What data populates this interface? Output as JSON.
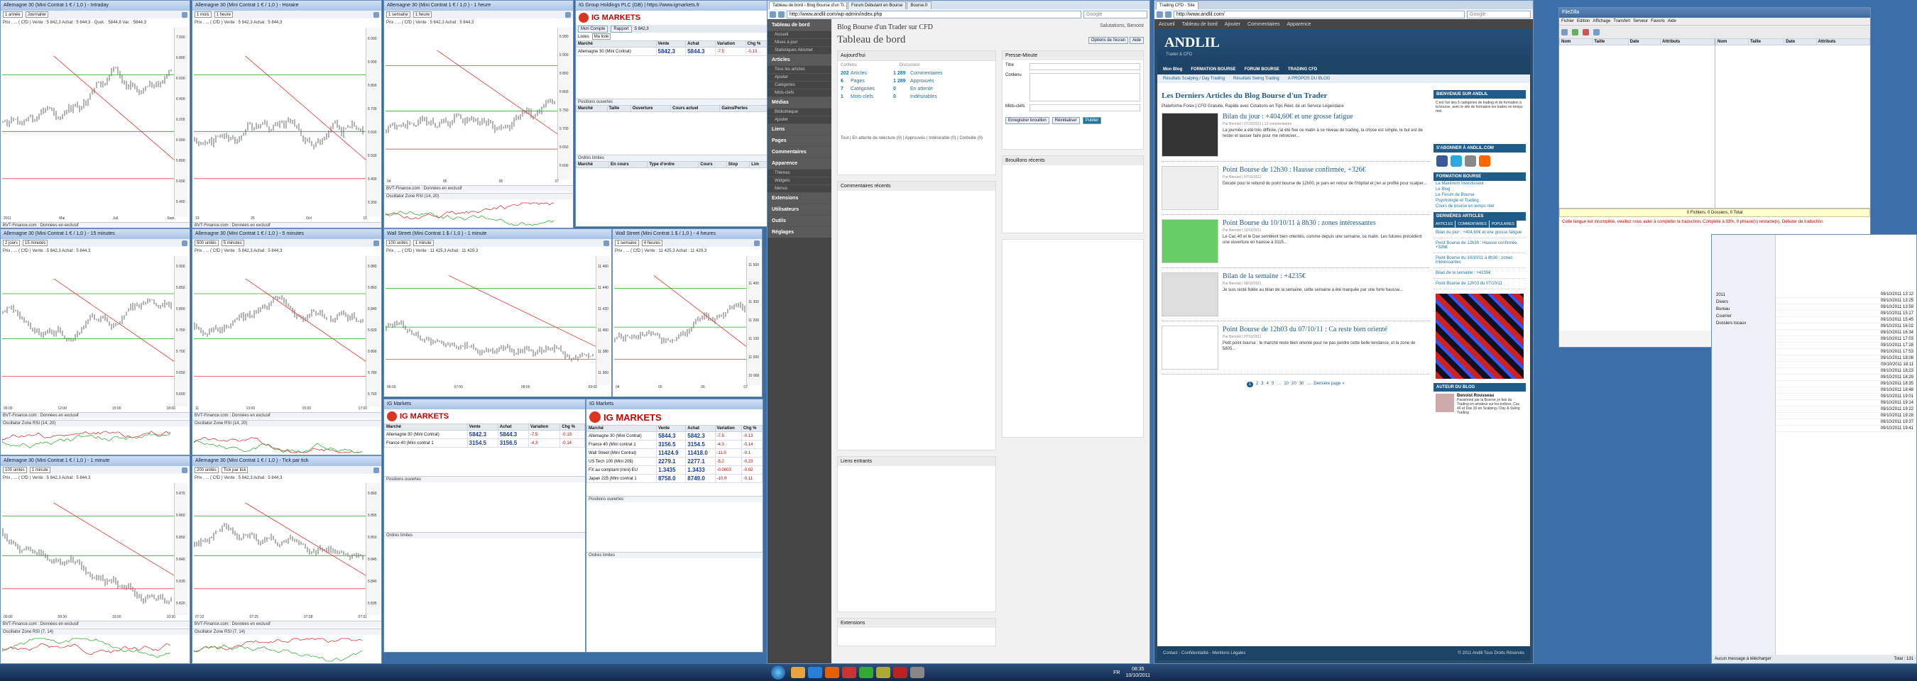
{
  "charts": [
    {
      "title": "Allemagne 30 (Mini Contrat 1 € / 1,0 ) - Intraday",
      "period": "1 année",
      "interval": "Journalier",
      "legend": "Prix , ... ( CfD ) Vente : 5 842,3 Achat : 5 844,3 - Quot. : 5844,8 Var. : 5844,3",
      "axis": [
        "7 000",
        "6 800",
        "6 600",
        "6 400",
        "6 200",
        "6 000",
        "5 800",
        "5 600",
        "5 400"
      ],
      "indicator": "BVT-Finance.com : Données en exclusif",
      "xticks": [
        "2011",
        "Mai",
        "Juil.",
        "Sept."
      ]
    },
    {
      "title": "Allemagne 30 (Mini Contrat 1 € / 1,0 ) - Horaire",
      "period": "1 mois",
      "interval": "1 heure",
      "legend": "Prix , ... ( CfD ) Vente : 5 842,3 Achat : 5 844,3",
      "axis": [
        "6 000",
        "5 900",
        "5 800",
        "5 700",
        "5 600",
        "5 500",
        "5 400",
        "5 300"
      ],
      "indicator": "BVT-Finance.com : Données en exclusif",
      "xticks": [
        "19",
        "26",
        "Oct",
        "10"
      ]
    },
    {
      "title": "Allemagne 30 (Mini Contrat 1 € / 1,0 ) - 1 heure",
      "period": "1 semaine",
      "interval": "1 heure",
      "legend": "Prix , ... ( CfD ) Vente : 5 842,3 Achat : 5 844,3",
      "axis": [
        "5 950",
        "5 900",
        "5 850",
        "5 800",
        "5 750",
        "5 700",
        "5 650",
        "5 600"
      ],
      "indicator": "BVT-Finance.com : Données en exclusif",
      "sub": "Oscillator Zone RSI (14, 20)",
      "xticks": [
        "04",
        "05",
        "06",
        "07"
      ]
    },
    {
      "title": "Allemagne 30 (Mini Contrat 1 € / 1,0 ) - 15 minutes",
      "period": "2 jours",
      "interval": "15 minutes",
      "legend": "Prix , ... ( CfD ) Vente : 5 842,3 Achat : 5 844,3",
      "axis": [
        "5 900",
        "5 850",
        "5 800",
        "5 750",
        "5 700",
        "5 650",
        "5 600"
      ],
      "indicator": "BVT-Finance.com : Données en exclusif",
      "sub": "Oscillator Zone RSI (14, 20)",
      "xticks": [
        "09:00",
        "12:00",
        "15:00",
        "18:00"
      ]
    },
    {
      "title": "Allemagne 30 (Mini Contrat 1 € / 1,0 ) - 5 minutes",
      "period": "500 unités",
      "interval": "5 minutes",
      "legend": "Prix , ... ( CfD ) Vente : 5 842,3 Achat : 5 844,3",
      "axis": [
        "5 880",
        "5 860",
        "5 840",
        "5 820",
        "5 800",
        "5 780",
        "5 760"
      ],
      "indicator": "BVT-Finance.com : Données en exclusif",
      "sub": "Oscillator Zone RSI (14, 20)",
      "xticks": [
        "11",
        "13:00",
        "15:00",
        "17:00"
      ]
    },
    {
      "title": "Wall Street (Mini Contrat 1 $ / 1,0 ) - 1 minute",
      "period": "100 unités",
      "interval": "1 minute",
      "legend": "Prix , ... ( CfD ) Vente : 11 425,3 Achat : 11 429,3",
      "axis": [
        "11 460",
        "11 440",
        "11 420",
        "11 400",
        "11 380",
        "11 360"
      ],
      "indicator": "",
      "xticks": [
        "06:00",
        "07:00",
        "08:00",
        "09:00"
      ]
    },
    {
      "title": "Wall Street (Mini Contrat 1 $ / 1,0 ) - 4 heures",
      "period": "1 semaine",
      "interval": "4 heures",
      "legend": "Prix , ... ( CfD ) Vente : 11 425,3 Achat : 11 429,3",
      "axis": [
        "11 500",
        "11 400",
        "11 300",
        "11 200",
        "11 100",
        "11 000",
        "10 900"
      ],
      "indicator": "",
      "xticks": [
        "04",
        "05",
        "06",
        "07"
      ]
    },
    {
      "title": "Allemagne 30 (Mini Contrat 1 € / 1,0 ) - 1 minute",
      "period": "100 unités",
      "interval": "1 minute",
      "legend": "Prix , ... ( CfD ) Vente : 5 842,3 Achat : 5 844,3",
      "axis": [
        "5 870",
        "5 860",
        "5 850",
        "5 840",
        "5 830",
        "5 820"
      ],
      "indicator": "BVT-Finance.com : Données en exclusif",
      "sub": "Oscillator Zone RSI (7, 14)",
      "xticks": [
        "09:00",
        "09:30",
        "10:00",
        "10:30"
      ]
    },
    {
      "title": "Allemagne 30 (Mini Contrat 1 € / 1,0 ) - Tick par tick",
      "period": "200 unités",
      "interval": "Tick par tick",
      "legend": "Prix , ... ( CfD ) Vente : 5 842,3 Achat : 5 844,3",
      "axis": [
        "5 860",
        "5 855",
        "5 850",
        "5 845",
        "5 840",
        "5 835"
      ],
      "indicator": "BVT-Finance.com : Données en exclusif",
      "sub": "Oscillator Zone RSI (7, 14)",
      "xticks": [
        "07:22",
        "07:25",
        "07:28",
        "07:31"
      ]
    }
  ],
  "ig_top": {
    "title": "IG Group Holdings PLC (GB) | https://www.igmarkets.fr",
    "brand": "IG MARKETS",
    "account": "Mon Compte",
    "report": "Rapport",
    "balance": "5 842,3",
    "lists_label": "Listes",
    "lists_value": "Ma liste",
    "cols": [
      "Marché",
      "Vente",
      "Achat",
      "Variation",
      "Chg %"
    ],
    "rows": [
      {
        "m": "Allemagne 30 (Mini Contrat)",
        "v": "5842.3",
        "a": "5844.3",
        "c": "-7.5",
        "p": "-0.13"
      }
    ],
    "positions": "Positions ouvertes",
    "pos_cols": [
      "Marché",
      "Taille",
      "Ouverture",
      "Cours actuel",
      "Gains/Pertes"
    ],
    "orders": "Ordres limites",
    "ord_cols": [
      "Marché",
      "En cours",
      "Type d'ordre",
      "Cours",
      "Stop",
      "Lim"
    ]
  },
  "ig_mid": {
    "title": "IG Markets",
    "brand": "IG MARKETS",
    "cols": [
      "Marché",
      "Vente",
      "Achat",
      "Variation",
      "Chg %"
    ],
    "rows": [
      {
        "m": "Allemagne 30 (Mini Contrat)",
        "v": "5842.3",
        "a": "5844.3",
        "c": "-7.5",
        "p": "-0.13"
      },
      {
        "m": "France 40 (Mini contrat 1",
        "v": "3154.5",
        "a": "3156.5",
        "c": "-4.3",
        "p": "-0.14"
      }
    ],
    "positions": "Positions ouvertes",
    "orders": "Ordres limites"
  },
  "ig_right": {
    "title": "IG Markets",
    "brand": "IG MARKETS",
    "cols": [
      "Marché",
      "Vente",
      "Achat",
      "Variation",
      "Chg %"
    ],
    "rows": [
      {
        "m": "Allemagne 30 (Mini Contrat)",
        "v": "5844.3",
        "a": "5842.3",
        "c": "-7.5",
        "p": "-0.13"
      },
      {
        "m": "France 40 (Mini contrat 1",
        "v": "3156.5",
        "a": "3154.5",
        "c": "-4.3",
        "p": "-0.14"
      },
      {
        "m": "Wall Street (Mini Contrat)",
        "v": "11424.9",
        "a": "11418.0",
        "c": "-11.0",
        "p": "-0.1"
      },
      {
        "m": "US Tech 100 (Mini 20$)",
        "v": "2279.1",
        "a": "2277.1",
        "c": "-5.2",
        "p": "-0.23"
      },
      {
        "m": "FX au comptant (mini) EU",
        "v": "1.3435",
        "a": "1.3433",
        "c": "-0.0003",
        "p": "-0.02"
      },
      {
        "m": "Japan 225 (Mini contrat 1",
        "v": "8758.0",
        "a": "8749.0",
        "c": "-10.0",
        "p": "-0.11"
      }
    ],
    "positions": "Positions ouvertes",
    "orders": "Ordres limites"
  },
  "wp": {
    "tabs": [
      "Tableau de bord ‹ Blog Bourse d'un Tr...",
      "Forum Débutant en Bourse",
      "Bourse.fr",
      "Trading CFD - Site"
    ],
    "url": "http://www.andlil.com/wp-admin/index.php",
    "search": "Google",
    "site": "Blog Bourse d'un Trader sur CFD",
    "page_title": "Tableau de bord",
    "menu": [
      "Tableau de bord",
      "Accueil",
      "Mises à jour",
      "Statistiques Akismet",
      "Articles",
      "Tous les articles",
      "Ajouter",
      "Catégories",
      "Mots-clefs",
      "Médias",
      "Bibliothèque",
      "Ajouter",
      "Liens",
      "Pages",
      "Commentaires",
      "Apparence",
      "Thèmes",
      "Widgets",
      "Menus",
      "Extensions",
      "Utilisateurs",
      "Outils",
      "Réglages"
    ],
    "now": "Aujourd'hui",
    "content": "Contenu",
    "discussion": "Discussion",
    "stats": [
      {
        "n": "202",
        "l": "Articles",
        "n2": "1 289",
        "l2": "Commentaires"
      },
      {
        "n": "6",
        "l": "Pages",
        "n2": "1 289",
        "l2": "Approuvés"
      },
      {
        "n": "7",
        "l": "Catégories",
        "n2": "0",
        "l2": "En attente"
      },
      {
        "n": "1",
        "l": "Mots-clefs",
        "n2": "0",
        "l2": "Indésirables"
      }
    ],
    "quickpress": "Presse-Minute",
    "qp_fields": [
      "Titre",
      "Contenu",
      "Mots-clefs"
    ],
    "save_draft": "Enregistrer brouillon",
    "reset": "Réinitialiser",
    "publish": "Publier",
    "drafts": "Brouillons récents",
    "recent_comments": "Commentaires récents",
    "incoming": "Liens entrants",
    "plugins": "Extensions",
    "footer_links": "Tout | En attente de relecture (0) | Approuvés | Indésirable (0) | Corbeille (0)",
    "screen": "Options de l'écran",
    "help": "Aide",
    "howdy": "Salutations, Benoist"
  },
  "blog": {
    "url": "http://www.andlil.com/",
    "logo": "ANDLIL",
    "logo_sub": "Trader & CFD",
    "nav": [
      "Accueil",
      "Tableau de bord",
      "Ajouter",
      "Commentaires",
      "Apparence"
    ],
    "nav2": [
      "Mon Blog",
      "FORMATION BOURSE",
      "FORUM BOURSE",
      "TRADING CFD"
    ],
    "nav3": [
      "Résultats Scalping / Day Trading",
      "Résultats Swing Trading",
      "A PROPOS DU BLOG"
    ],
    "heading": "Les Derniers Articles du Blog Bourse d'un Trader",
    "intro": "Plateforme Forex | CFD Gratuite, Rapide avec Cotations en Tips Réel, dé un Service Légendaire",
    "posts": [
      {
        "t": "Bilan du jour : +404,60€ et une grosse fatigue",
        "m": "Par Benoist | 07/10/2011 | 12 commentaires",
        "e": "La journée a été très difficile, j'ai été fixe ce matin à ce niveau de trading, la chose est simple, le but est de rester et laisser faire pour me retrouver..."
      },
      {
        "t": "Point Bourse de 12h30 : Hausse confirmée, +326€",
        "m": "Par Benoist | 07/10/2011",
        "e": "Décidé pour le rebond du point bourse de 12h00, je pars en retour de l'hôpital et j'en ai profité pour scalper..."
      },
      {
        "t": "Point Bourse du 10/10/11 à 8h30 : zones intéressantes",
        "m": "Par Benoist | 10/10/2011",
        "e": "Le Cac 40 et le Dax semblent bien orientés, comme depuis une semaine, ce matin. Les futures précédent une ouverture en hausse à 3115..."
      },
      {
        "t": "Bilan de la semaine : +4235€",
        "m": "Par Benoist | 08/10/2011",
        "e": "Je suis resté fidèle au bilan de la semaine, cette semaine a été marquée par une forte hausse..."
      },
      {
        "t": "Point Bourse de 12h03 du 07/10/11 : Ca reste bien orienté",
        "m": "Par Benoist | 07/10/2011",
        "e": "Petit point bourse : le marché reste bien orienté pour ne pas perdre cette belle tendance, et la zone de 5805..."
      }
    ],
    "pager": [
      "1",
      "2",
      "3",
      "4",
      "5",
      "…",
      "10",
      "20",
      "30",
      "…",
      "Dernière page »"
    ],
    "side_titles": [
      "BIENVENUE SUR ANDLIL",
      "S'ABONNER À ANDLIL.COM",
      "FORMATION BOURSE",
      "DERNIÈRES ARTICLES",
      "AUTEUR DU BLOG"
    ],
    "side_tabs": [
      "ARTICLES",
      "COMMENTAIRES",
      "POPULAIRES"
    ],
    "welcome": "C'est l'un des 5 catégories de trading et de formation à la bourse, avec le site de formation les trades en temps réel.",
    "side_links": [
      "La Maximum Investisseur",
      "Le Blog",
      "Le Forum de Bourse",
      "Psychologie et Trading",
      "Cours de bourse en temps réel"
    ],
    "recent": [
      "Bilan du jour : +404,60€ et une grosse fatigue",
      "Point Bourse de 12h30 : Hausse confirmée, +326€",
      "Point Bourse du 10/10/11 à 8h30 : zones intéressantes",
      "Bilan de la semaine : +4235€",
      "Point Bourse de 12h03 du 07/10/11"
    ],
    "author": "Benoist Rousseau",
    "author_txt": "Passionné par la Bourse, je fais du Trading en amateur sur les indices, Cac 40 et Dax 30 en Scalping / Day & Swing Trading",
    "footer": "Contact - Confidentialité - Mentions Légales",
    "copyright": "© 2011 Andlil Tous Droits Réservés"
  },
  "ftp": {
    "title": "FileZilla",
    "menu": [
      "Fichier",
      "Edition",
      "Affichage",
      "Transfert",
      "Serveur",
      "Favoris",
      "Aide"
    ],
    "cols_local": [
      "Nom",
      "Taille",
      "Date",
      "Attributs"
    ],
    "status": "0 Fichiers, 0 Dossiers, 0 Total",
    "msg": "Cette langue est incomplète, veuillez nous aider à compléter la traduction. Complété à 93%, 0 phrase(s) restante(s). Débuter de traduction",
    "cols_remote": [
      "Nom",
      "Taille",
      "Date",
      "Attributs"
    ],
    "tree": [
      "2011",
      "Divers",
      "Bureau",
      "Courrier",
      "Dossiers locaux"
    ],
    "date_list": [
      "09/10/2011 13:12",
      "09/10/2011 13:25",
      "09/10/2011 13:59",
      "09/10/2011 15:17",
      "09/10/2011 15:45",
      "09/10/2011 16:02",
      "09/10/2011 16:34",
      "09/10/2011 17:03",
      "09/10/2011 17:28",
      "09/10/2011 17:53",
      "09/10/2011 18:08",
      "09/10/2011 18:11",
      "09/10/2011 18:23",
      "09/10/2011 18:29",
      "09/10/2011 18:35",
      "09/10/2011 18:48",
      "09/10/2011 19:01",
      "09/10/2011 19:14",
      "09/10/2011 19:22",
      "09/10/2011 19:28",
      "09/10/2011 19:37",
      "09/10/2011 19:41"
    ],
    "queue": "Aucun message à télécharger",
    "total": "Total : 131"
  },
  "taskbar": {
    "clock_time": "08:35",
    "clock_date": "10/10/2011",
    "lang": "FR"
  }
}
